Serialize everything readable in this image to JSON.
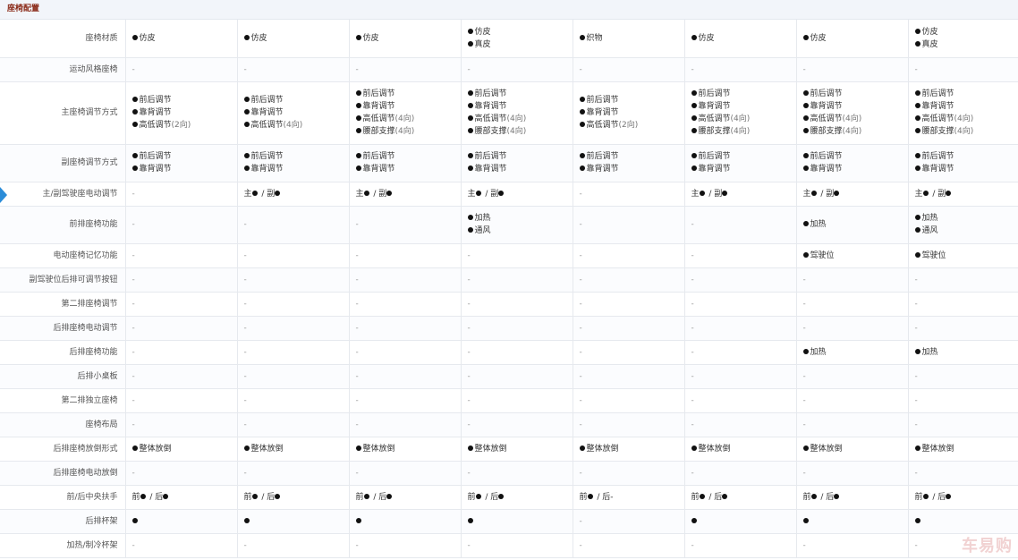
{
  "section": {
    "title": "座椅配置"
  },
  "watermark": "车易购",
  "rows": [
    {
      "label": "座椅材质",
      "h": 42,
      "cells": [
        [
          "●仿皮"
        ],
        [
          "●仿皮"
        ],
        [
          "●仿皮"
        ],
        [
          "●仿皮",
          "●真皮"
        ],
        [
          "●织物"
        ],
        [
          "●仿皮"
        ],
        [
          "●仿皮"
        ],
        [
          "●仿皮",
          "●真皮"
        ]
      ]
    },
    {
      "label": "运动风格座椅",
      "h": 27,
      "cells": [
        [
          "-"
        ],
        [
          "-"
        ],
        [
          "-"
        ],
        [
          "-"
        ],
        [
          "-"
        ],
        [
          "-"
        ],
        [
          "-"
        ],
        [
          "-"
        ]
      ]
    },
    {
      "label": "主座椅调节方式",
      "h": 70,
      "cells": [
        [
          "●前后调节",
          "●靠背调节",
          "●高低调节(2向)"
        ],
        [
          "●前后调节",
          "●靠背调节",
          "●高低调节(4向)"
        ],
        [
          "●前后调节",
          "●靠背调节",
          "●高低调节(4向)",
          "●腰部支撑(4向)"
        ],
        [
          "●前后调节",
          "●靠背调节",
          "●高低调节(4向)",
          "●腰部支撑(4向)"
        ],
        [
          "●前后调节",
          "●靠背调节",
          "●高低调节(2向)"
        ],
        [
          "●前后调节",
          "●靠背调节",
          "●高低调节(4向)",
          "●腰部支撑(4向)"
        ],
        [
          "●前后调节",
          "●靠背调节",
          "●高低调节(4向)",
          "●腰部支撑(4向)"
        ],
        [
          "●前后调节",
          "●靠背调节",
          "●高低调节(4向)",
          "●腰部支撑(4向)"
        ]
      ]
    },
    {
      "label": "副座椅调节方式",
      "h": 42,
      "cells": [
        [
          "●前后调节",
          "●靠背调节"
        ],
        [
          "●前后调节",
          "●靠背调节"
        ],
        [
          "●前后调节",
          "●靠背调节"
        ],
        [
          "●前后调节",
          "●靠背调节"
        ],
        [
          "●前后调节",
          "●靠背调节"
        ],
        [
          "●前后调节",
          "●靠背调节"
        ],
        [
          "●前后调节",
          "●靠背调节"
        ],
        [
          "●前后调节",
          "●靠背调节"
        ]
      ]
    },
    {
      "label": "主/副驾驶座电动调节",
      "h": 27,
      "cells": [
        [
          "-"
        ],
        [
          "主● / 副●"
        ],
        [
          "主● / 副●"
        ],
        [
          "主● / 副●"
        ],
        [
          "-"
        ],
        [
          "主● / 副●"
        ],
        [
          "主● / 副●"
        ],
        [
          "主● / 副●"
        ]
      ]
    },
    {
      "label": "前排座椅功能",
      "h": 42,
      "cells": [
        [
          "-"
        ],
        [
          "-"
        ],
        [
          "-"
        ],
        [
          "●加热",
          "●通风"
        ],
        [
          "-"
        ],
        [
          "-"
        ],
        [
          "●加热"
        ],
        [
          "●加热",
          "●通风"
        ]
      ]
    },
    {
      "label": "电动座椅记忆功能",
      "h": 27,
      "cells": [
        [
          "-"
        ],
        [
          "-"
        ],
        [
          "-"
        ],
        [
          "-"
        ],
        [
          "-"
        ],
        [
          "-"
        ],
        [
          "●驾驶位"
        ],
        [
          "●驾驶位"
        ]
      ]
    },
    {
      "label": "副驾驶位后排可调节按钮",
      "h": 27,
      "cells": [
        [
          "-"
        ],
        [
          "-"
        ],
        [
          "-"
        ],
        [
          "-"
        ],
        [
          "-"
        ],
        [
          "-"
        ],
        [
          "-"
        ],
        [
          "-"
        ]
      ]
    },
    {
      "label": "第二排座椅调节",
      "h": 27,
      "cells": [
        [
          "-"
        ],
        [
          "-"
        ],
        [
          "-"
        ],
        [
          "-"
        ],
        [
          "-"
        ],
        [
          "-"
        ],
        [
          "-"
        ],
        [
          "-"
        ]
      ]
    },
    {
      "label": "后排座椅电动调节",
      "h": 27,
      "cells": [
        [
          "-"
        ],
        [
          "-"
        ],
        [
          "-"
        ],
        [
          "-"
        ],
        [
          "-"
        ],
        [
          "-"
        ],
        [
          "-"
        ],
        [
          "-"
        ]
      ]
    },
    {
      "label": "后排座椅功能",
      "h": 27,
      "cells": [
        [
          "-"
        ],
        [
          "-"
        ],
        [
          "-"
        ],
        [
          "-"
        ],
        [
          "-"
        ],
        [
          "-"
        ],
        [
          "●加热"
        ],
        [
          "●加热"
        ]
      ]
    },
    {
      "label": "后排小桌板",
      "h": 27,
      "cells": [
        [
          "-"
        ],
        [
          "-"
        ],
        [
          "-"
        ],
        [
          "-"
        ],
        [
          "-"
        ],
        [
          "-"
        ],
        [
          "-"
        ],
        [
          "-"
        ]
      ]
    },
    {
      "label": "第二排独立座椅",
      "h": 27,
      "cells": [
        [
          "-"
        ],
        [
          "-"
        ],
        [
          "-"
        ],
        [
          "-"
        ],
        [
          "-"
        ],
        [
          "-"
        ],
        [
          "-"
        ],
        [
          "-"
        ]
      ]
    },
    {
      "label": "座椅布局",
      "h": 27,
      "cells": [
        [
          "-"
        ],
        [
          "-"
        ],
        [
          "-"
        ],
        [
          "-"
        ],
        [
          "-"
        ],
        [
          "-"
        ],
        [
          "-"
        ],
        [
          "-"
        ]
      ]
    },
    {
      "label": "后排座椅放倒形式",
      "h": 27,
      "cells": [
        [
          "●整体放倒"
        ],
        [
          "●整体放倒"
        ],
        [
          "●整体放倒"
        ],
        [
          "●整体放倒"
        ],
        [
          "●整体放倒"
        ],
        [
          "●整体放倒"
        ],
        [
          "●整体放倒"
        ],
        [
          "●整体放倒"
        ]
      ]
    },
    {
      "label": "后排座椅电动放倒",
      "h": 27,
      "cells": [
        [
          "-"
        ],
        [
          "-"
        ],
        [
          "-"
        ],
        [
          "-"
        ],
        [
          "-"
        ],
        [
          "-"
        ],
        [
          "-"
        ],
        [
          "-"
        ]
      ]
    },
    {
      "label": "前/后中央扶手",
      "h": 27,
      "cells": [
        [
          "前● / 后●"
        ],
        [
          "前● / 后●"
        ],
        [
          "前● / 后●"
        ],
        [
          "前● / 后●"
        ],
        [
          "前● / 后-"
        ],
        [
          "前● / 后●"
        ],
        [
          "前● / 后●"
        ],
        [
          "前● / 后●"
        ]
      ]
    },
    {
      "label": "后排杯架",
      "h": 27,
      "cells": [
        [
          "●"
        ],
        [
          "●"
        ],
        [
          "●"
        ],
        [
          "●"
        ],
        [
          "-"
        ],
        [
          "●"
        ],
        [
          "●"
        ],
        [
          "●"
        ]
      ]
    },
    {
      "label": "加热/制冷杯架",
      "h": 27,
      "cells": [
        [
          "-"
        ],
        [
          "-"
        ],
        [
          "-"
        ],
        [
          "-"
        ],
        [
          "-"
        ],
        [
          "-"
        ],
        [
          "-"
        ],
        [
          "-"
        ]
      ]
    }
  ]
}
